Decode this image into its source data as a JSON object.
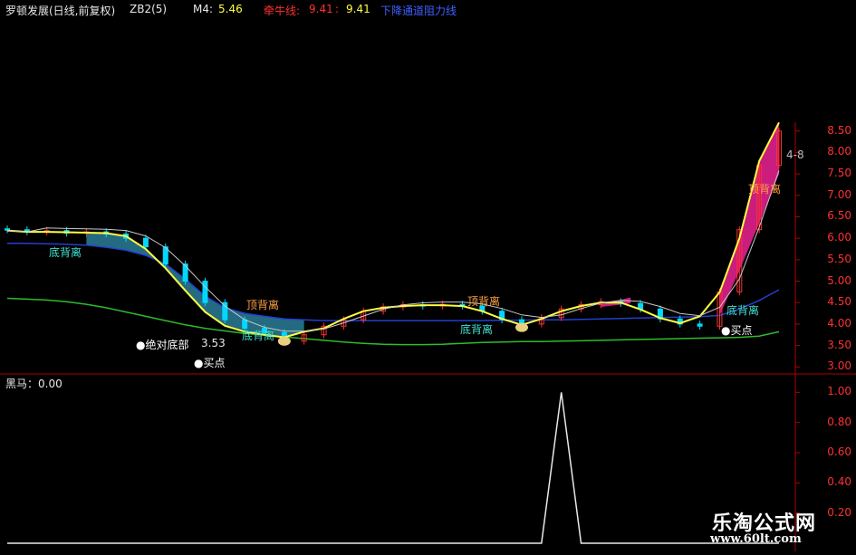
{
  "header": {
    "stock_title": "罗顿发展(日线,前复权)",
    "indicator": "ZB2(5)",
    "m4_label": "M4:",
    "m4_value": "5.46",
    "niuniu_label": "牵牛线:",
    "niuniu_value1": "9.41",
    "niuniu_value2": "9.41",
    "blue_text": "下降通道阻力线"
  },
  "main_labels": {
    "bottom_back_1": "底背离",
    "bottom_back_2": "底背离",
    "bottom_back_3": "底背离",
    "bottom_back_4": "底背离",
    "top_back_1": "顶背离",
    "top_back_2": "顶背离",
    "top_back_3": "顶背离",
    "absolute_bottom": "●绝对底部",
    "price_annotation": "3.53",
    "buy_point_1": "●买点",
    "buy_point_2": "●买点",
    "corner_tag": "4-8"
  },
  "sub_panel": {
    "label": "黑马：0.00"
  },
  "watermark": {
    "title": "乐淘公式网",
    "url": "www.60lt.com"
  },
  "colors": {
    "background": "#000000",
    "axis_red": "#b00000",
    "tick_red": "#ff3030",
    "up_candle": "#ff3030",
    "down_candle": "#00d8ff",
    "yellow_line": "#ffff40",
    "green_line": "#2cbc2c",
    "blue_line": "#2040d0",
    "cyan_label": "#40e0d0",
    "orange_label": "#ffa040",
    "magenta_fill": "#e0208c",
    "teal_fill": "#2a7e98"
  },
  "chart_data": [
    {
      "type": "line",
      "panel": "price",
      "title": "罗顿发展(日线,前复权)",
      "ylim": [
        2.9,
        8.6
      ],
      "y_ticks": [
        "3.00",
        "3.50",
        "4.00",
        "4.50",
        "5.00",
        "5.50",
        "6.00",
        "6.50",
        "7.00",
        "7.50",
        "8.00",
        "8.50"
      ],
      "series": [
        {
          "name": "M4",
          "values": [
            6.18,
            6.15,
            6.15,
            6.14,
            6.13,
            6.12,
            6.05,
            5.75,
            5.3,
            4.78,
            4.28,
            3.96,
            3.82,
            3.75,
            3.69,
            3.82,
            3.9,
            4.12,
            4.3,
            4.38,
            4.42,
            4.44,
            4.44,
            4.42,
            4.3,
            4.12,
            3.98,
            4.12,
            4.3,
            4.42,
            4.5,
            4.5,
            4.34,
            4.14,
            4.02,
            4.18,
            4.74,
            6.0,
            7.8,
            8.7
          ]
        },
        {
          "name": "牵牛线",
          "values": [
            4.6,
            4.58,
            4.56,
            4.52,
            4.46,
            4.38,
            4.28,
            4.18,
            4.08,
            3.98,
            3.9,
            3.84,
            3.78,
            3.74,
            3.7,
            3.66,
            3.62,
            3.58,
            3.55,
            3.53,
            3.52,
            3.52,
            3.53,
            3.55,
            3.57,
            3.58,
            3.59,
            3.59,
            3.6,
            3.61,
            3.62,
            3.63,
            3.64,
            3.65,
            3.66,
            3.67,
            3.68,
            3.69,
            3.72,
            3.82
          ]
        },
        {
          "name": "下降通道阻力线",
          "values": [
            5.88,
            5.88,
            5.87,
            5.86,
            5.84,
            5.79,
            5.72,
            5.6,
            5.4,
            5.05,
            4.65,
            4.38,
            4.25,
            4.18,
            4.12,
            4.1,
            4.08,
            4.08,
            4.08,
            4.08,
            4.08,
            4.08,
            4.08,
            4.08,
            4.08,
            4.09,
            4.09,
            4.1,
            4.1,
            4.11,
            4.12,
            4.13,
            4.14,
            4.15,
            4.16,
            4.17,
            4.2,
            4.35,
            4.55,
            4.8
          ]
        }
      ],
      "candles_close": [
        6.2,
        6.15,
        6.18,
        6.12,
        6.15,
        6.1,
        6.0,
        5.8,
        5.4,
        5.0,
        4.5,
        4.1,
        3.9,
        3.8,
        3.6,
        3.75,
        3.95,
        4.1,
        4.3,
        4.4,
        4.45,
        4.42,
        4.46,
        4.42,
        4.3,
        4.1,
        4.0,
        4.15,
        4.35,
        4.45,
        4.52,
        4.48,
        4.35,
        4.12,
        4.0,
        3.95,
        4.75,
        6.2,
        7.7,
        8.5
      ]
    },
    {
      "type": "line",
      "panel": "sub",
      "title": "黑马",
      "ylim": [
        0,
        1.05
      ],
      "y_ticks": [
        "0.20",
        "0.40",
        "0.60",
        "0.80",
        "1.00"
      ],
      "series": [
        {
          "name": "黑马",
          "x": [
            0,
            1,
            2,
            3,
            4,
            5,
            6,
            7,
            8,
            9,
            10,
            11,
            12,
            13,
            14,
            15,
            16,
            17,
            18,
            19,
            20,
            21,
            22,
            23,
            24,
            25,
            26,
            27,
            28,
            29,
            30,
            31,
            32,
            33,
            34,
            35,
            36,
            37,
            38,
            39
          ],
          "values": [
            0,
            0,
            0,
            0,
            0,
            0,
            0,
            0,
            0,
            0,
            0,
            0,
            0,
            0,
            0,
            0,
            0,
            0,
            0,
            0,
            0,
            0,
            0,
            0,
            0,
            0,
            0,
            0,
            1,
            0,
            0,
            0,
            0,
            0,
            0,
            0,
            0,
            0,
            0,
            0
          ]
        }
      ]
    }
  ]
}
